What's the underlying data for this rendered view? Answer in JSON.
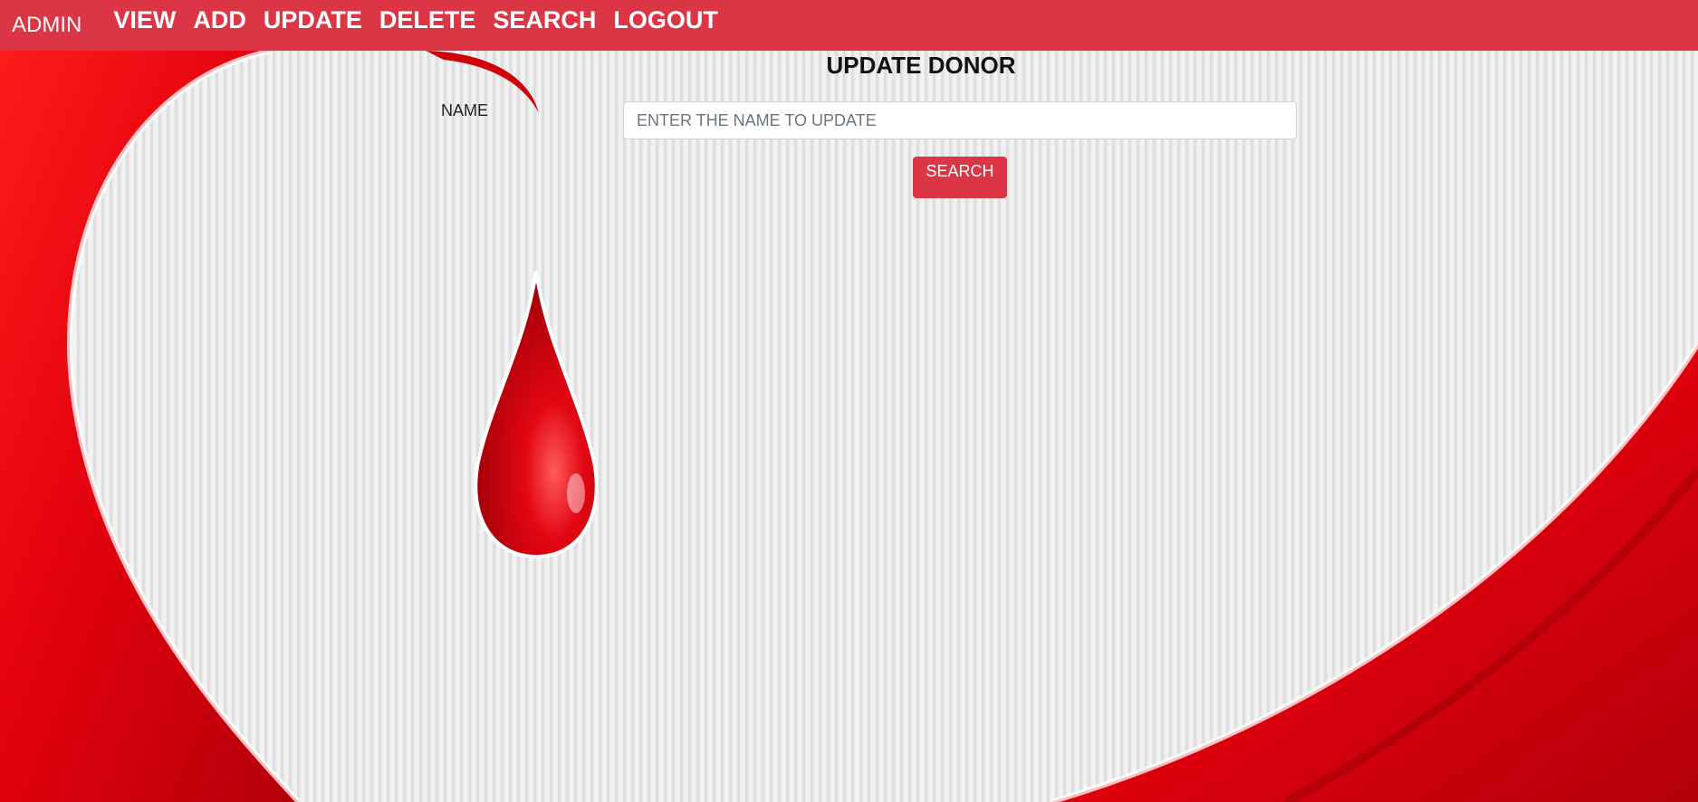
{
  "navbar": {
    "brand": "ADMIN",
    "links": [
      "VIEW",
      "ADD",
      "UPDATE",
      "DELETE",
      "SEARCH",
      "LOGOUT"
    ],
    "background_color": "#dc3545"
  },
  "form": {
    "title": "UPDATE DONOR",
    "name_label": "NAME",
    "name_placeholder": "ENTER THE NAME TO UPDATE",
    "name_value": "",
    "search_label": "SEARCH"
  },
  "background": {
    "icon": "blood-drop-icon",
    "accent_color": "#e30613"
  }
}
